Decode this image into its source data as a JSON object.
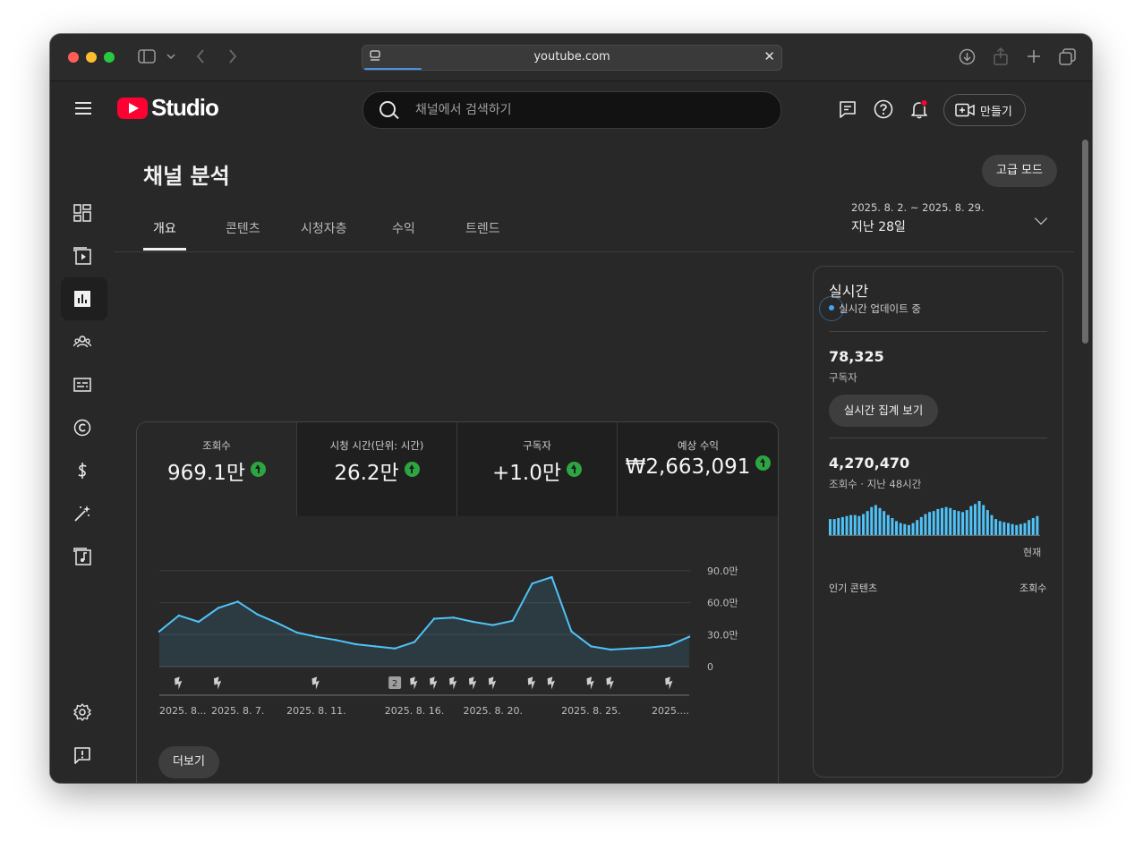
{
  "browser": {
    "url": "youtube.com"
  },
  "header": {
    "logo_text": "Studio",
    "search_placeholder": "채널에서 검색하기",
    "create_label": "만들기"
  },
  "page": {
    "title": "채널 분석",
    "advanced_mode": "고급 모드",
    "tabs": [
      {
        "label": "개요",
        "active": true
      },
      {
        "label": "콘텐츠",
        "active": false
      },
      {
        "label": "시청자층",
        "active": false
      },
      {
        "label": "수익",
        "active": false
      },
      {
        "label": "트렌드",
        "active": false
      }
    ],
    "date_range": "2025. 8. 2. ~ 2025. 8. 29.",
    "date_label": "지난 28일"
  },
  "metrics": [
    {
      "label": "조회수",
      "value": "969.1만",
      "trend": "up"
    },
    {
      "label": "시청 시간(단위: 시간)",
      "value": "26.2만",
      "trend": "up"
    },
    {
      "label": "구독자",
      "value": "+1.0만",
      "trend": "up"
    },
    {
      "label": "예상 수익",
      "value": "₩2,663,091",
      "trend": "up"
    }
  ],
  "chart_data": {
    "type": "area",
    "ylim": [
      0,
      100
    ],
    "y_ticks": [
      "0",
      "30.0만",
      "60.0만",
      "90.0만"
    ],
    "y_tick_values": [
      0,
      30,
      60,
      90
    ],
    "x_ticks": [
      "2025. 8...",
      "2025. 8. 7.",
      "2025. 8. 11.",
      "2025. 8. 16.",
      "2025. 8. 20.",
      "2025. 8. 25.",
      "2025...."
    ],
    "x_tick_index": [
      0,
      4,
      8,
      13,
      17,
      22,
      26
    ],
    "values": [
      33,
      48,
      42,
      55,
      61,
      49,
      41,
      32,
      28,
      25,
      21,
      19,
      17,
      23,
      45,
      46,
      42,
      39,
      43,
      78,
      84,
      33,
      19,
      16,
      17,
      18,
      20,
      28
    ],
    "series_color": "#4fc3f7",
    "markers": [
      {
        "index": 1,
        "type": "short"
      },
      {
        "index": 3,
        "type": "short"
      },
      {
        "index": 8,
        "type": "short"
      },
      {
        "index": 12,
        "type": "count",
        "count": "2"
      },
      {
        "index": 13,
        "type": "short"
      },
      {
        "index": 14,
        "type": "short"
      },
      {
        "index": 15,
        "type": "short"
      },
      {
        "index": 16,
        "type": "short"
      },
      {
        "index": 17,
        "type": "short"
      },
      {
        "index": 19,
        "type": "short"
      },
      {
        "index": 20,
        "type": "short"
      },
      {
        "index": 22,
        "type": "short"
      },
      {
        "index": 23,
        "type": "short"
      },
      {
        "index": 26,
        "type": "short"
      }
    ]
  },
  "more_label": "더보기",
  "realtime": {
    "title": "실시간",
    "live_label": "실시간 업데이트 중",
    "subscribers_value": "78,325",
    "subscribers_label": "구독자",
    "button_label": "실시간 집계 보기",
    "views_value": "4,270,470",
    "views_label": "조회수 · 지난 48시간",
    "now_label": "현재",
    "top_content_label": "인기 콘텐츠",
    "views_col_label": "조회수",
    "bar_values": [
      16,
      16,
      17,
      18,
      19,
      20,
      20,
      19,
      21,
      24,
      28,
      30,
      27,
      24,
      20,
      17,
      14,
      12,
      11,
      10,
      12,
      15,
      18,
      21,
      23,
      24,
      26,
      27,
      28,
      27,
      25,
      24,
      23,
      25,
      29,
      31,
      34,
      30,
      25,
      20,
      16,
      14,
      13,
      12,
      11,
      10,
      11,
      12,
      15,
      17,
      19
    ],
    "bar_color": "#4fc3f7"
  }
}
